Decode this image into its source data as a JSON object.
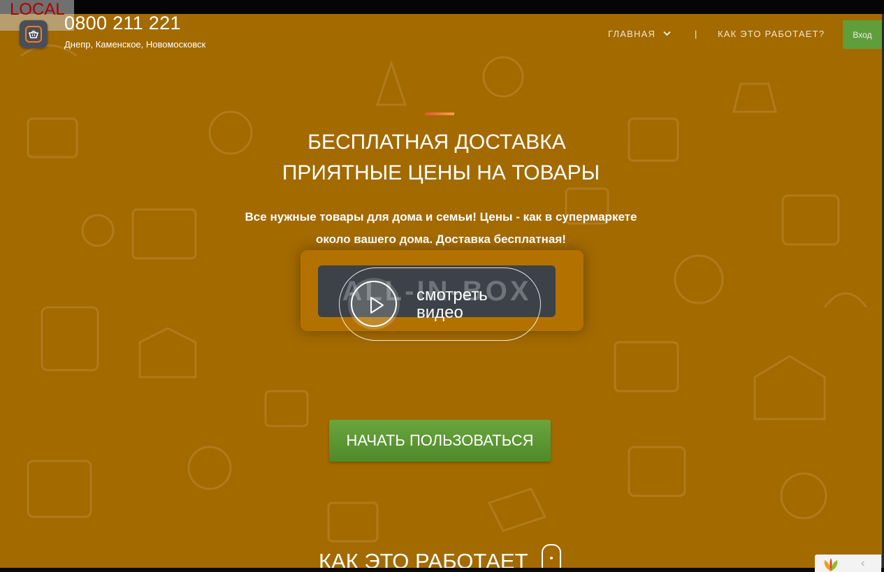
{
  "debug_badge": "LOCAL",
  "header": {
    "phone": "0800 211 221",
    "cities": "Днепр, Каменское, Новомосковск",
    "logo_icon": "basket-icon"
  },
  "nav": {
    "home": "ГЛАВНАЯ",
    "separator": "|",
    "how": "КАК ЭТО РАБОТАЕТ?",
    "login": "Вход"
  },
  "hero": {
    "headline_1": "БЕСПЛАТНАЯ ДОСТАВКА",
    "headline_2": "ПРИЯТНЫЕ ЦЕНЫ НА ТОВАРЫ",
    "sub_1": "Все нужные товары для дома и семьи! Цены - как в супермаркете",
    "sub_2": "около вашего дома. Доставка бесплатная!",
    "box_label": "ALL-IN-BOX",
    "video_line_1": "смотреть",
    "video_line_2": "видео",
    "start_button": "НАЧАТЬ ПОЛЬЗОВАТЬСЯ"
  },
  "section": {
    "how_title": "КАК ЭТО РАБОТАЕТ"
  },
  "colors": {
    "hero_bg": "#a36a00",
    "accent_green": "#5f9e3a",
    "accent_orange": "#f47a2a"
  }
}
